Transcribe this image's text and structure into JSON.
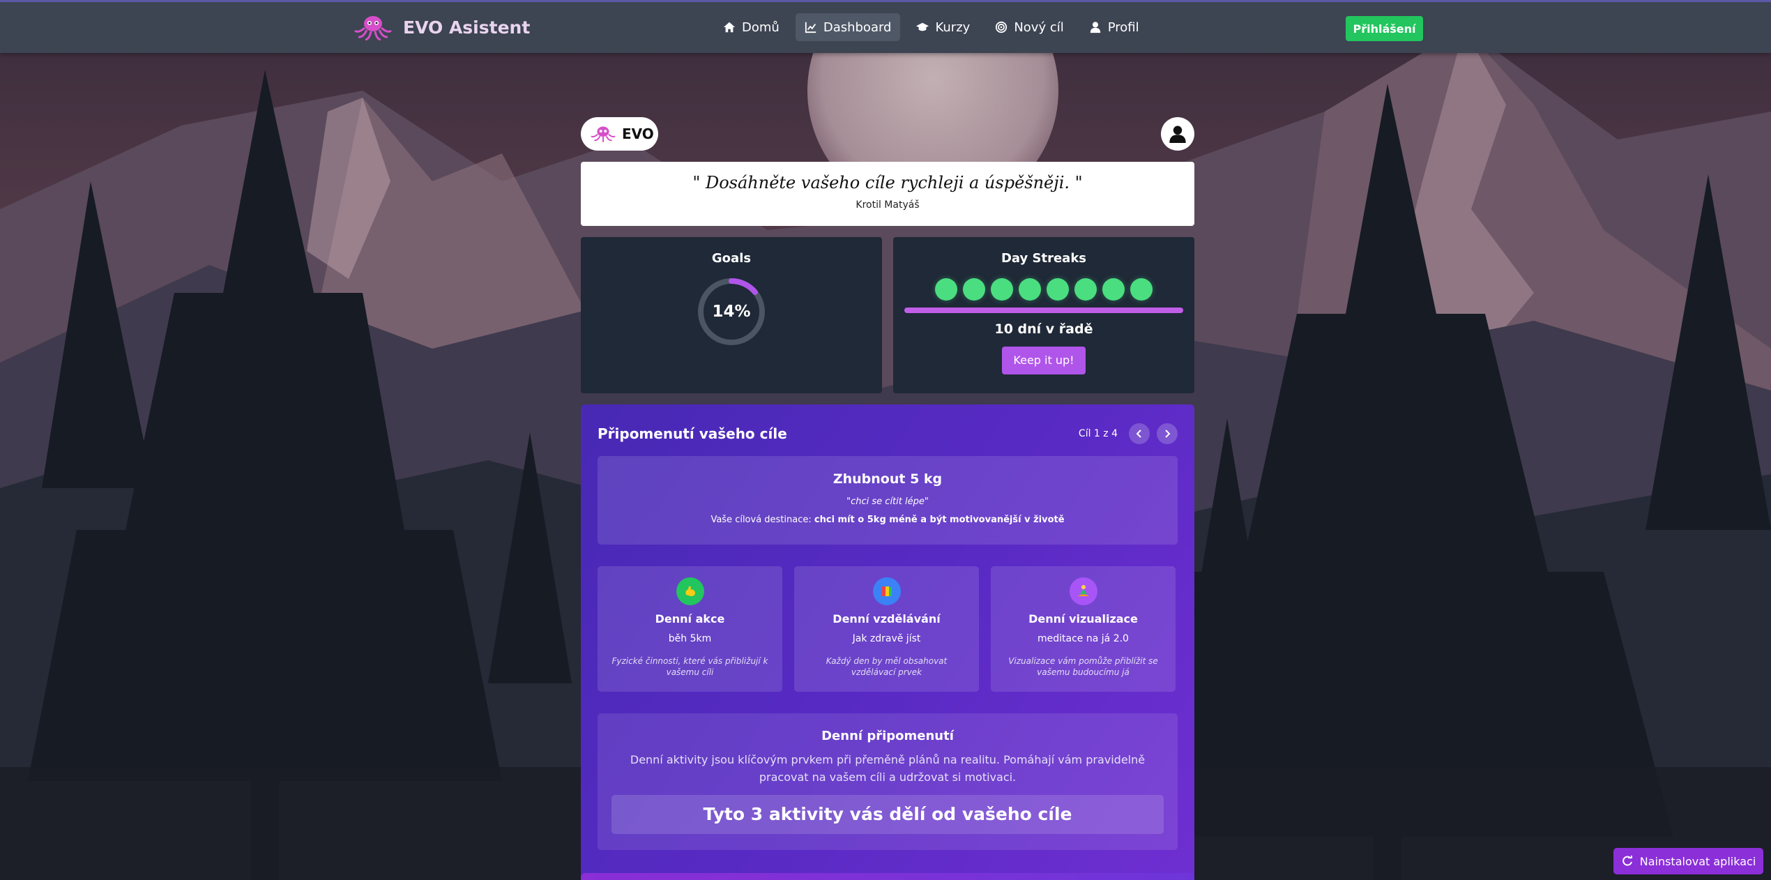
{
  "app": {
    "title": "EVO Asistent"
  },
  "nav": {
    "items": [
      {
        "label": "Domů",
        "icon": "home-icon"
      },
      {
        "label": "Dashboard",
        "icon": "chart-line-icon",
        "active": true
      },
      {
        "label": "Kurzy",
        "icon": "graduation-cap-icon"
      },
      {
        "label": "Nový cíl",
        "icon": "target-icon"
      },
      {
        "label": "Profil",
        "icon": "user-icon"
      }
    ],
    "login_label": "Přihlášení"
  },
  "header": {
    "evo_label": "EVO"
  },
  "quote": {
    "text": "\" Dosáhněte vašeho cíle rychleji a úspěšněji. \"",
    "author": "Krotil Matyáš"
  },
  "goals_card": {
    "title": "Goals",
    "progress": 0.14,
    "label": "14%"
  },
  "streak_card": {
    "title": "Day Streaks",
    "dots_count": 8,
    "days_text": "10 dní v řadě",
    "button_label": "Keep it up!"
  },
  "goal_reminder": {
    "title": "Připomenutí vašeho cíle",
    "pager_text": "Cíl 1 z 4",
    "goal": {
      "name": "Zhubnout 5 kg",
      "why": "\"chci se cítit lépe\"",
      "destination_prefix": "Vaše cílová destinace: ",
      "destination": "chci mít o 5kg méně a být motivovanější v životě"
    },
    "activities": [
      {
        "title": "Denní akce",
        "value": "běh 5km",
        "desc": "Fyzické činnosti, které vás přibližují k vašemu cíli",
        "icon": "flexed-biceps-icon",
        "color": "#22c55e"
      },
      {
        "title": "Denní vzdělávání",
        "value": "Jak zdravě jíst",
        "desc": "Každý den by měl obsahovat vzdělávací prvek",
        "icon": "books-icon",
        "color": "#3b82f6"
      },
      {
        "title": "Denní vizualizace",
        "value": "meditace na já 2.0",
        "desc": "Vizualizace vám pomůže přiblížit se vašemu budoucímu já",
        "icon": "meditation-icon",
        "color": "#a855f7"
      }
    ],
    "reminder": {
      "title": "Denní připomenutí",
      "text": "Denní aktivity jsou klíčovým prvkem při přeměně plánů na realitu. Pomáhají vám pravidelně pracovat na vašem cíli a udržovat si motivaci.",
      "cta": "Tyto 3 aktivity vás dělí od vašeho cíle"
    }
  },
  "install": {
    "label": "Nainstalovat aplikaci"
  },
  "colors": {
    "accent": "#b055ea",
    "success": "#22c55e",
    "streak_dot": "#4ade80",
    "panel": "#1f2937"
  }
}
